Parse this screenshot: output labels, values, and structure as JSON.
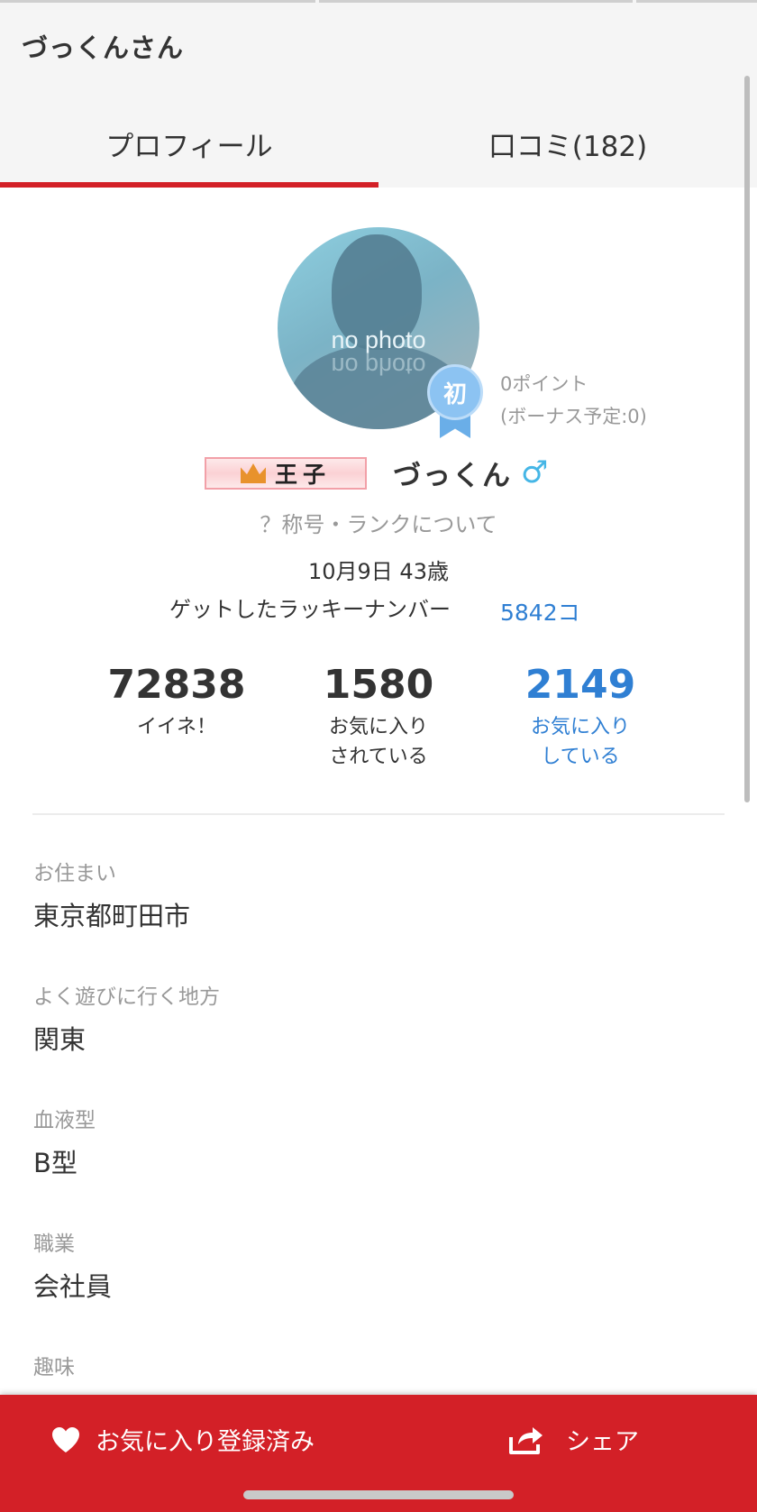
{
  "header": {
    "title": "づっくんさん"
  },
  "tabs": [
    {
      "label": "プロフィール"
    },
    {
      "label": "口コミ(182)"
    }
  ],
  "avatar": {
    "placeholder_text": "no photo"
  },
  "badge": {
    "text": "初"
  },
  "points": {
    "line1": "0ポイント",
    "line2": "(ボーナス予定:0)"
  },
  "profile": {
    "title_badge": "王子",
    "name": "づっくん",
    "gender_symbol": "♂",
    "rank_link": "？称号・ランクについて",
    "birthday": "10月9日 43歳",
    "lucky_label": "ゲットしたラッキーナンバー",
    "lucky_value": "5842コ"
  },
  "stats": [
    {
      "value": "72838",
      "label1": "イイネ！",
      "label2": ""
    },
    {
      "value": "1580",
      "label1": "お気に入り",
      "label2": "されている"
    },
    {
      "value": "2149",
      "label1": "お気に入り",
      "label2": "している"
    }
  ],
  "fields": [
    {
      "label": "お住まい",
      "value": "東京都町田市"
    },
    {
      "label": "よく遊びに行く地方",
      "value": "関東"
    },
    {
      "label": "血液型",
      "value": "B型"
    },
    {
      "label": "職業",
      "value": "会社員"
    },
    {
      "label": "趣味",
      "value": ""
    }
  ],
  "bottom_bar": {
    "favorite_label": "お気に入り登録済み",
    "share_label": "シェア"
  },
  "colors": {
    "accent": "#d32027",
    "link": "#2f7fd3",
    "gender": "#45b6e6"
  }
}
